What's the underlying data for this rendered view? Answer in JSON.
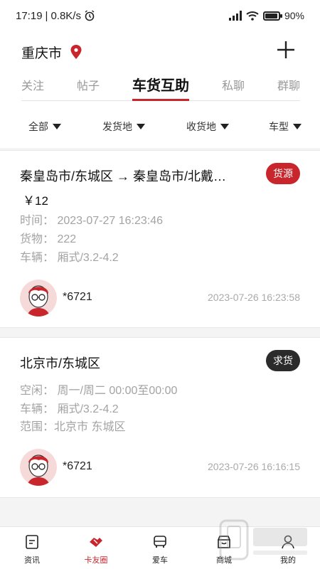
{
  "status": {
    "time": "17:19",
    "speed": "0.8K/s",
    "battery": "90%"
  },
  "header": {
    "city": "重庆市",
    "tabs": [
      {
        "label": "关注"
      },
      {
        "label": "帖子"
      },
      {
        "label": "车货互助"
      },
      {
        "label": "私聊"
      },
      {
        "label": "群聊"
      }
    ],
    "active_tab": "车货互助",
    "filters": [
      {
        "label": "全部"
      },
      {
        "label": "发货地"
      },
      {
        "label": "收货地"
      },
      {
        "label": "车型"
      }
    ]
  },
  "posts": [
    {
      "route": "秦皇岛市/东城区 → 秦皇岛市/北戴…",
      "badge": "货源",
      "price": "￥12",
      "lines": [
        "时间：  2023-07-27 16:23:46",
        "货物：  222",
        "车辆：  厢式/3.2-4.2"
      ],
      "user": "*6721",
      "timestamp": "2023-07-26 16:23:58"
    },
    {
      "route": "北京市/东城区",
      "badge": "求货",
      "lines": [
        "空闲：  周一/周二 00:00至00:00",
        "车辆：  厢式/3.2-4.2",
        "范围：北京市 东城区"
      ],
      "user": "*6721",
      "timestamp": "2023-07-26 16:16:15"
    }
  ],
  "bottom_nav": [
    {
      "label": "资讯",
      "icon": "news-icon"
    },
    {
      "label": "卡友圈",
      "icon": "handshake-icon"
    },
    {
      "label": "爱车",
      "icon": "truck-icon"
    },
    {
      "label": "商城",
      "icon": "shop-icon"
    },
    {
      "label": "我的",
      "icon": "profile-icon"
    }
  ],
  "colors": {
    "accent": "#c8262c",
    "dark_badge": "#2b2b2b",
    "muted": "#a3a3a3"
  }
}
